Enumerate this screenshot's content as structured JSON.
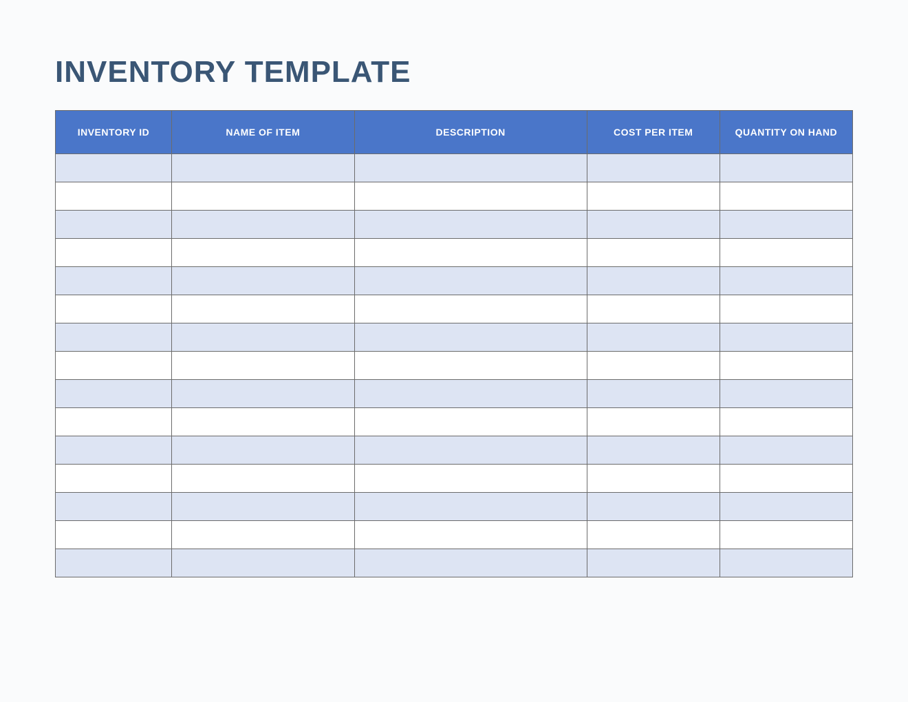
{
  "title": "INVENTORY TEMPLATE",
  "columns": [
    "INVENTORY ID",
    "NAME OF ITEM",
    "DESCRIPTION",
    "COST PER ITEM",
    "QUANTITY ON HAND"
  ],
  "rows": [
    {
      "inventory_id": "",
      "name": "",
      "description": "",
      "cost_per_item": "",
      "quantity_on_hand": ""
    },
    {
      "inventory_id": "",
      "name": "",
      "description": "",
      "cost_per_item": "",
      "quantity_on_hand": ""
    },
    {
      "inventory_id": "",
      "name": "",
      "description": "",
      "cost_per_item": "",
      "quantity_on_hand": ""
    },
    {
      "inventory_id": "",
      "name": "",
      "description": "",
      "cost_per_item": "",
      "quantity_on_hand": ""
    },
    {
      "inventory_id": "",
      "name": "",
      "description": "",
      "cost_per_item": "",
      "quantity_on_hand": ""
    },
    {
      "inventory_id": "",
      "name": "",
      "description": "",
      "cost_per_item": "",
      "quantity_on_hand": ""
    },
    {
      "inventory_id": "",
      "name": "",
      "description": "",
      "cost_per_item": "",
      "quantity_on_hand": ""
    },
    {
      "inventory_id": "",
      "name": "",
      "description": "",
      "cost_per_item": "",
      "quantity_on_hand": ""
    },
    {
      "inventory_id": "",
      "name": "",
      "description": "",
      "cost_per_item": "",
      "quantity_on_hand": ""
    },
    {
      "inventory_id": "",
      "name": "",
      "description": "",
      "cost_per_item": "",
      "quantity_on_hand": ""
    },
    {
      "inventory_id": "",
      "name": "",
      "description": "",
      "cost_per_item": "",
      "quantity_on_hand": ""
    },
    {
      "inventory_id": "",
      "name": "",
      "description": "",
      "cost_per_item": "",
      "quantity_on_hand": ""
    },
    {
      "inventory_id": "",
      "name": "",
      "description": "",
      "cost_per_item": "",
      "quantity_on_hand": ""
    },
    {
      "inventory_id": "",
      "name": "",
      "description": "",
      "cost_per_item": "",
      "quantity_on_hand": ""
    },
    {
      "inventory_id": "",
      "name": "",
      "description": "",
      "cost_per_item": "",
      "quantity_on_hand": ""
    }
  ],
  "colors": {
    "title": "#3a5675",
    "header_bg": "#4a76c9",
    "row_alt": "#dde4f3",
    "border": "#6b6b6b"
  }
}
